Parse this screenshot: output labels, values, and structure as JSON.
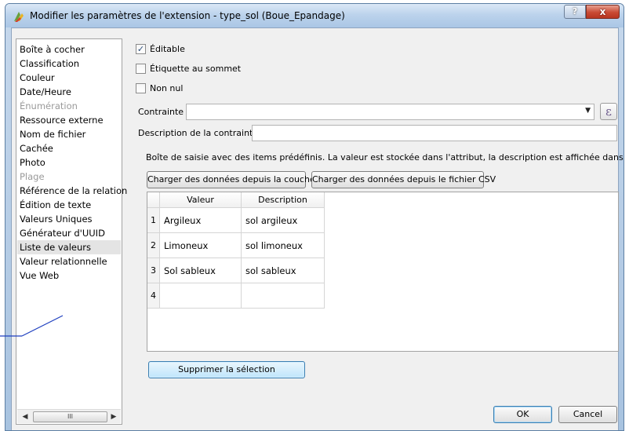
{
  "window": {
    "title": "Modifier les paramètres de l'extension - type_sol (Boue_Epandage)",
    "help_label": "?",
    "close_label": "x"
  },
  "sidebar": {
    "items": [
      {
        "label": "Boîte à cocher",
        "disabled": false,
        "selected": false
      },
      {
        "label": "Classification",
        "disabled": false,
        "selected": false
      },
      {
        "label": "Couleur",
        "disabled": false,
        "selected": false
      },
      {
        "label": "Date/Heure",
        "disabled": false,
        "selected": false
      },
      {
        "label": "Énumération",
        "disabled": true,
        "selected": false
      },
      {
        "label": "Ressource externe",
        "disabled": false,
        "selected": false
      },
      {
        "label": "Nom de fichier",
        "disabled": false,
        "selected": false
      },
      {
        "label": "Cachée",
        "disabled": false,
        "selected": false
      },
      {
        "label": "Photo",
        "disabled": false,
        "selected": false
      },
      {
        "label": "Plage",
        "disabled": true,
        "selected": false
      },
      {
        "label": "Référence de la relation",
        "disabled": false,
        "selected": false
      },
      {
        "label": "Édition de texte",
        "disabled": false,
        "selected": false
      },
      {
        "label": "Valeurs Uniques",
        "disabled": false,
        "selected": false
      },
      {
        "label": "Générateur d'UUID",
        "disabled": false,
        "selected": false
      },
      {
        "label": "Liste de valeurs",
        "disabled": false,
        "selected": true
      },
      {
        "label": "Valeur relationnelle",
        "disabled": false,
        "selected": false
      },
      {
        "label": "Vue Web",
        "disabled": false,
        "selected": false
      }
    ],
    "scroll_thumb_label": "III"
  },
  "options": {
    "editable": {
      "label": "Éditable",
      "checked": true
    },
    "label_on_top": {
      "label": "Étiquette au sommet",
      "checked": false
    },
    "not_null": {
      "label": "Non nul",
      "checked": false
    }
  },
  "constraint": {
    "label": "Contrainte",
    "value": "",
    "expression_button": "ε"
  },
  "constraint_description": {
    "label": "Description de la contrainte",
    "value": ""
  },
  "description_text": "Boîte de saisie avec des items prédéfinis. La valeur est stockée dans l'attribut, la description est affichée dans la boîte.",
  "buttons": {
    "load_from_layer": "Charger des données depuis la couche",
    "load_from_csv": "Charger des données depuis le fichier CSV",
    "remove_selection": "Supprimer la sélection",
    "ok": "OK",
    "cancel": "Cancel"
  },
  "table": {
    "headers": [
      "Valeur",
      "Description"
    ],
    "rows": [
      {
        "num": "1",
        "value": "Argileux",
        "description": "sol argileux"
      },
      {
        "num": "2",
        "value": "Limoneux",
        "description": "sol limoneux"
      },
      {
        "num": "3",
        "value": "Sol sableux",
        "description": "sol sableux"
      },
      {
        "num": "4",
        "value": "",
        "description": ""
      }
    ]
  },
  "colors": {
    "titlebar": "#bcd3ec",
    "close_button": "#c94a34",
    "annotation_line": "#1f3fbf"
  }
}
